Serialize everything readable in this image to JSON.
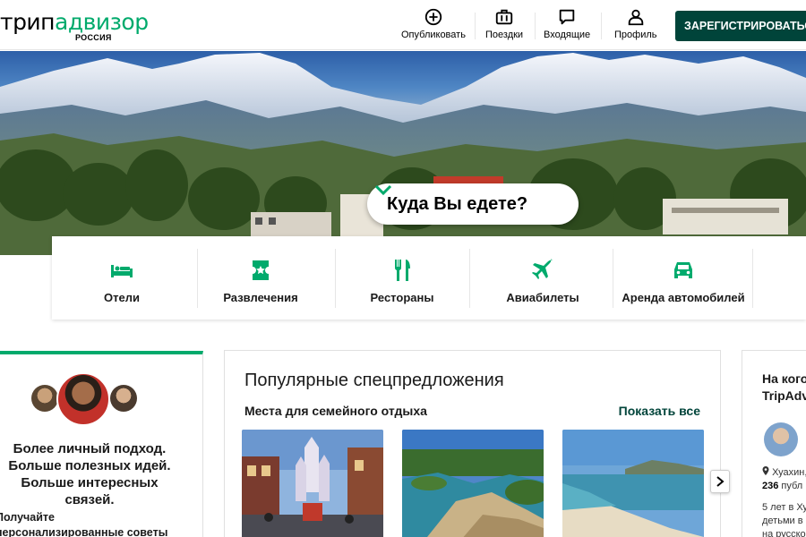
{
  "header": {
    "logo_part1": "трип",
    "logo_part2": "адвизор",
    "logo_sub": "РОССИЯ",
    "nav": [
      {
        "label": "Опубликовать",
        "icon": "plus-circle-icon"
      },
      {
        "label": "Поездки",
        "icon": "briefcase-icon"
      },
      {
        "label": "Входящие",
        "icon": "message-icon"
      },
      {
        "label": "Профиль",
        "icon": "user-icon"
      }
    ],
    "signup_label": "ЗАРЕГИСТРИРОВАТЬСЯ"
  },
  "hero": {
    "search_label": "Куда Вы едете?"
  },
  "categories": [
    {
      "label": "Отели",
      "icon": "bed-icon"
    },
    {
      "label": "Развлечения",
      "icon": "ticket-icon"
    },
    {
      "label": "Рестораны",
      "icon": "fork-knife-icon"
    },
    {
      "label": "Авиабилеты",
      "icon": "plane-icon"
    },
    {
      "label": "Аренда автомобилей",
      "icon": "car-icon"
    }
  ],
  "left_card": {
    "lines": [
      "Более личный подход.",
      "Больше полезных идей.",
      "Больше интересных связей."
    ],
    "tip_lines": [
      "Получайте",
      "персонализированные советы"
    ]
  },
  "deals": {
    "title": "Популярные спецпредложения",
    "subtitle": "Места для семейного отдыха",
    "show_all": "Показать все"
  },
  "right_card": {
    "question_line1": "На кого",
    "question_line2": "TripAdv",
    "location": "Хуахин,",
    "publications_count": "236",
    "publications_label": "публ",
    "bio_lines": [
      "5 лет в Ху",
      "детьми в",
      "на русско"
    ]
  },
  "colors": {
    "brand_green": "#00aa6c",
    "dark_green": "#00443a"
  }
}
